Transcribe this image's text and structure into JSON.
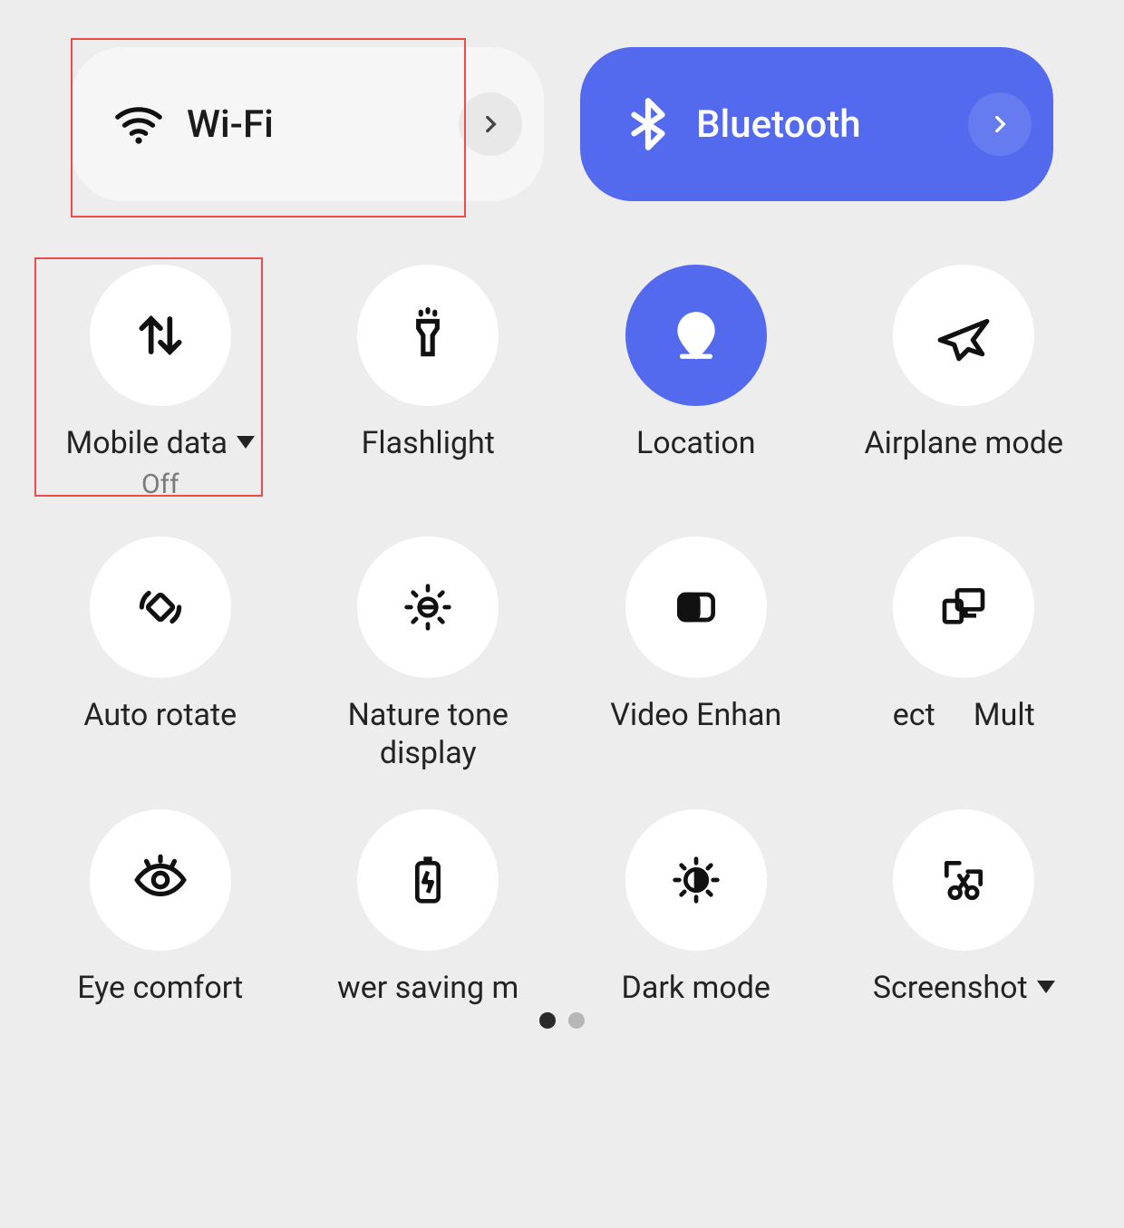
{
  "accent": "#5369ee",
  "top": {
    "wifi": {
      "label": "Wi-Fi",
      "active": false
    },
    "bluetooth": {
      "label": "Bluetooth",
      "active": true
    }
  },
  "tiles": [
    {
      "id": "mobile-data",
      "label": "Mobile data",
      "sub": "Off",
      "dropdown": true,
      "active": false,
      "icon": "data-arrows"
    },
    {
      "id": "flashlight",
      "label": "Flashlight",
      "sub": "",
      "dropdown": false,
      "active": false,
      "icon": "flashlight"
    },
    {
      "id": "location",
      "label": "Location",
      "sub": "",
      "dropdown": false,
      "active": true,
      "icon": "location-pin"
    },
    {
      "id": "airplane",
      "label": "Airplane mode",
      "sub": "",
      "dropdown": false,
      "active": false,
      "icon": "airplane"
    },
    {
      "id": "auto-rotate",
      "label": "Auto rotate",
      "sub": "",
      "dropdown": false,
      "active": false,
      "icon": "rotate"
    },
    {
      "id": "nature-tone",
      "label": "Nature tone display",
      "sub": "",
      "dropdown": false,
      "active": false,
      "icon": "sun-lines"
    },
    {
      "id": "video-enhance",
      "label": "Video Enhan",
      "sub": "",
      "dropdown": false,
      "active": false,
      "icon": "half-rect"
    },
    {
      "id": "multi",
      "label": "ect     Mult",
      "sub": "",
      "dropdown": false,
      "active": false,
      "icon": "devices"
    },
    {
      "id": "eye-comfort",
      "label": "Eye comfort",
      "sub": "",
      "dropdown": false,
      "active": false,
      "icon": "eye"
    },
    {
      "id": "power-saving",
      "label": "wer saving m",
      "sub": "",
      "dropdown": false,
      "active": false,
      "icon": "battery-bolt"
    },
    {
      "id": "dark-mode",
      "label": "Dark mode",
      "sub": "",
      "dropdown": false,
      "active": false,
      "icon": "half-sun"
    },
    {
      "id": "screenshot",
      "label": "Screenshot",
      "sub": "",
      "dropdown": true,
      "active": false,
      "icon": "crop-scissors"
    }
  ],
  "pager": {
    "count": 2,
    "active_index": 0
  }
}
